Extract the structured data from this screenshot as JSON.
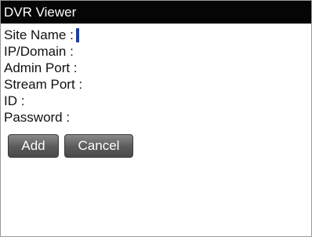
{
  "app": {
    "title": "DVR Viewer"
  },
  "form": {
    "fields": [
      {
        "label": "Site Name :",
        "value": ""
      },
      {
        "label": "IP/Domain :",
        "value": ""
      },
      {
        "label": "Admin Port :",
        "value": ""
      },
      {
        "label": "Stream Port :",
        "value": ""
      },
      {
        "label": "ID :",
        "value": ""
      },
      {
        "label": "Password :",
        "value": ""
      }
    ]
  },
  "buttons": {
    "add_label": "Add",
    "cancel_label": "Cancel"
  },
  "colors": {
    "title_bar_bg": "#050505",
    "caret": "#1f3f9f",
    "button_bg": "#5a5a5a"
  }
}
